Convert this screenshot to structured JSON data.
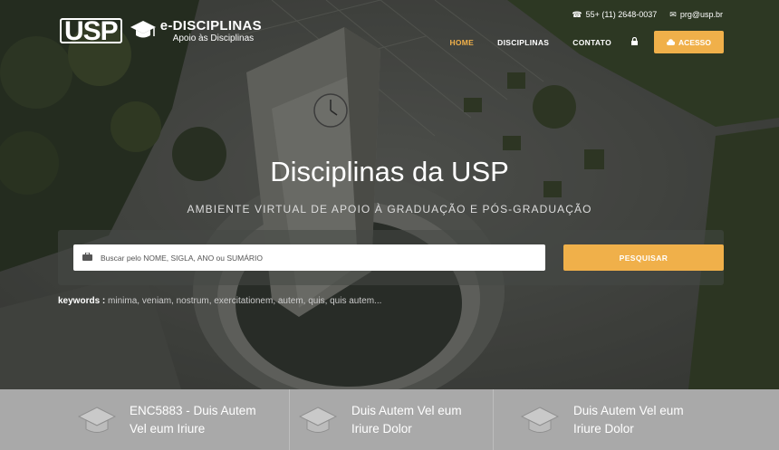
{
  "contact": {
    "phone_icon": "phone-icon",
    "phone": "55+ (11) 2648-0037",
    "email_icon": "envelope-icon",
    "email": "prg@usp.br"
  },
  "logo": {
    "mark": "USP",
    "title": "e-DISCIPLINAS",
    "subtitle": "Apoio às Disciplinas"
  },
  "nav": {
    "items": [
      {
        "label": "HOME",
        "active": true
      },
      {
        "label": "DISCIPLINAS",
        "active": false
      },
      {
        "label": "CONTATO",
        "active": false
      }
    ],
    "lock_icon": "lock-icon",
    "acesso_label": "ACESSO",
    "acesso_icon": "cloud-icon"
  },
  "hero": {
    "title": "Disciplinas da USP",
    "subtitle": "AMBIENTE VIRTUAL DE APOIO À GRADUAÇÃO E PÓS-GRADUAÇÃO"
  },
  "search": {
    "placeholder": "Buscar pelo NOME, SIGLA, ANO ou SUMÁRIO",
    "value": "",
    "button_label": "PESQUISAR",
    "icon": "briefcase-icon"
  },
  "keywords": {
    "label": "keywords :",
    "list": "minima, veniam, nostrum, exercitationem, autem, quis, quis autem..."
  },
  "courses": [
    {
      "line1": "ENC5883 - Duis Autem",
      "line2": "Vel eum Iriure",
      "icon": "graduation-cap-icon"
    },
    {
      "line1": "Duis Autem Vel eum",
      "line2": "Iriure Dolor",
      "icon": "graduation-cap-icon"
    },
    {
      "line1": "Duis Autem Vel eum",
      "line2": "Iriure Dolor",
      "icon": "graduation-cap-icon"
    }
  ],
  "colors": {
    "accent": "#f0b04a",
    "strip": "#a9a9a9"
  }
}
